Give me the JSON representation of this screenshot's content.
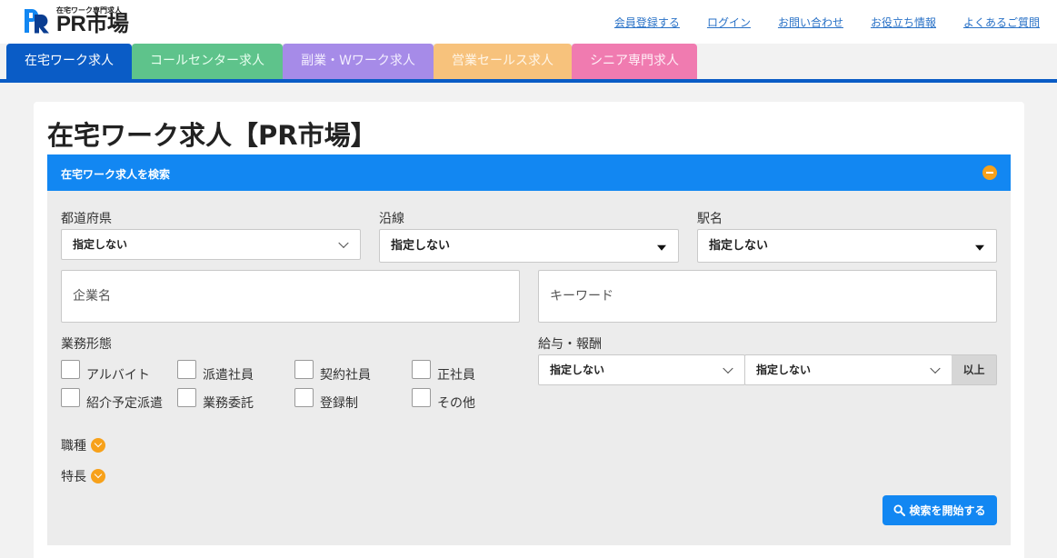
{
  "logo": {
    "small": "在宅ワーク専門求人",
    "main": "PR市場"
  },
  "topnav": [
    "会員登録する",
    "ログイン",
    "お問い合わせ",
    "お役立ち情報",
    "よくあるご質問"
  ],
  "tabs": [
    "在宅ワーク求人",
    "コールセンター求人",
    "副業・Wワーク求人",
    "営業セールス求人",
    "シニア専門求人"
  ],
  "page_title": "在宅ワーク求人【PR市場】",
  "search": {
    "bar_title": "在宅ワーク求人を検索",
    "prefecture": {
      "label": "都道府県",
      "value": "指定しない"
    },
    "line": {
      "label": "沿線",
      "value": "指定しない"
    },
    "station": {
      "label": "駅名",
      "value": "指定しない"
    },
    "company_placeholder": "企業名",
    "keyword_placeholder": "キーワード",
    "employment": {
      "label": "業務形態",
      "options": [
        "アルバイト",
        "派遣社員",
        "契約社員",
        "正社員",
        "紹介予定派遣",
        "業務委託",
        "登録制",
        "その他"
      ]
    },
    "salary": {
      "label": "給与・報酬",
      "type_value": "指定しない",
      "amount_value": "指定しない",
      "unit": "以上"
    },
    "job_type_label": "職種",
    "features_label": "特長",
    "submit_label": "検索を開始する"
  },
  "colors": {
    "primary": "#0a5cc6",
    "search_blue": "#1287f2",
    "accent_orange": "#f7a11a"
  }
}
